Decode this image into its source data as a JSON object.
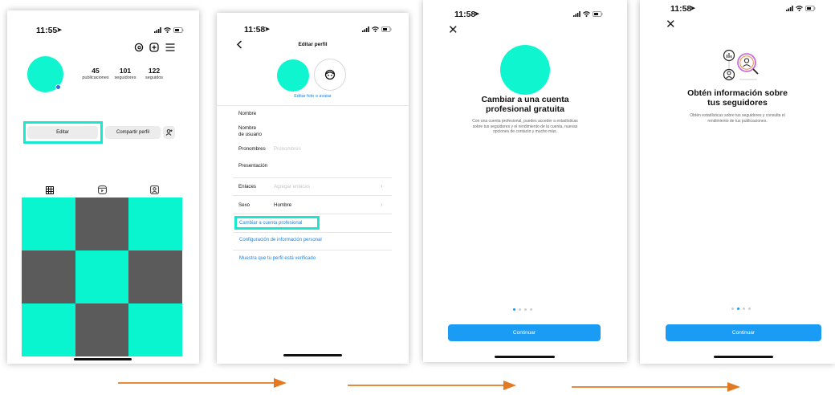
{
  "colors": {
    "accent": "#0ff5d0",
    "highlight": "#19e7cf",
    "blue": "#1a9cf5",
    "grid_dark": "#5b5b5b",
    "arrow": "#e37a22"
  },
  "screen1": {
    "time": "11:55",
    "stats": [
      {
        "value": "45",
        "label": "publicaciones"
      },
      {
        "value": "101",
        "label": "seguidores"
      },
      {
        "value": "122",
        "label": "seguidos"
      }
    ],
    "edit_label": "Editar",
    "share_label": "Compartir perfil",
    "grid": [
      "t",
      "g",
      "t",
      "g",
      "t",
      "g",
      "t",
      "g",
      "t"
    ]
  },
  "screen2": {
    "time": "11:58",
    "title": "Editar perfil",
    "edit_photo": "Editar foto o avatar",
    "fields": {
      "name": "Nombre",
      "username_1": "Nombre",
      "username_2": "de usuario",
      "pronouns": "Pronombres",
      "pronouns_placeholder": "Pronombres",
      "bio": "Presentación",
      "links": "Enlaces",
      "links_placeholder": "Agregar enlaces",
      "gender": "Sexo",
      "gender_value": "Hombre"
    },
    "switch_pro": "Cambiar a cuenta profesional",
    "personal_info": "Configuración de información personal",
    "verified": "Muestra que tu perfil está verificado"
  },
  "screen3": {
    "time": "11:58",
    "title_1": "Cambiar a una cuenta",
    "title_2": "profesional gratuita",
    "desc_1": "Con una cuenta profesional, puedes acceder a estadísticas",
    "desc_2": "sobre tus seguidores y el rendimiento de la cuenta, nuevas",
    "desc_3": "opciones de contacto y mucho más.",
    "continue": "Continuar",
    "active_dot": 0
  },
  "screen4": {
    "time": "11:58",
    "title_1": "Obtén información sobre",
    "title_2": "tus seguidores",
    "desc_1": "Obtén estadísticas sobre tus seguidores y consulta el",
    "desc_2": "rendimiento de tus publicaciones.",
    "continue": "Continuar",
    "active_dot": 1
  }
}
